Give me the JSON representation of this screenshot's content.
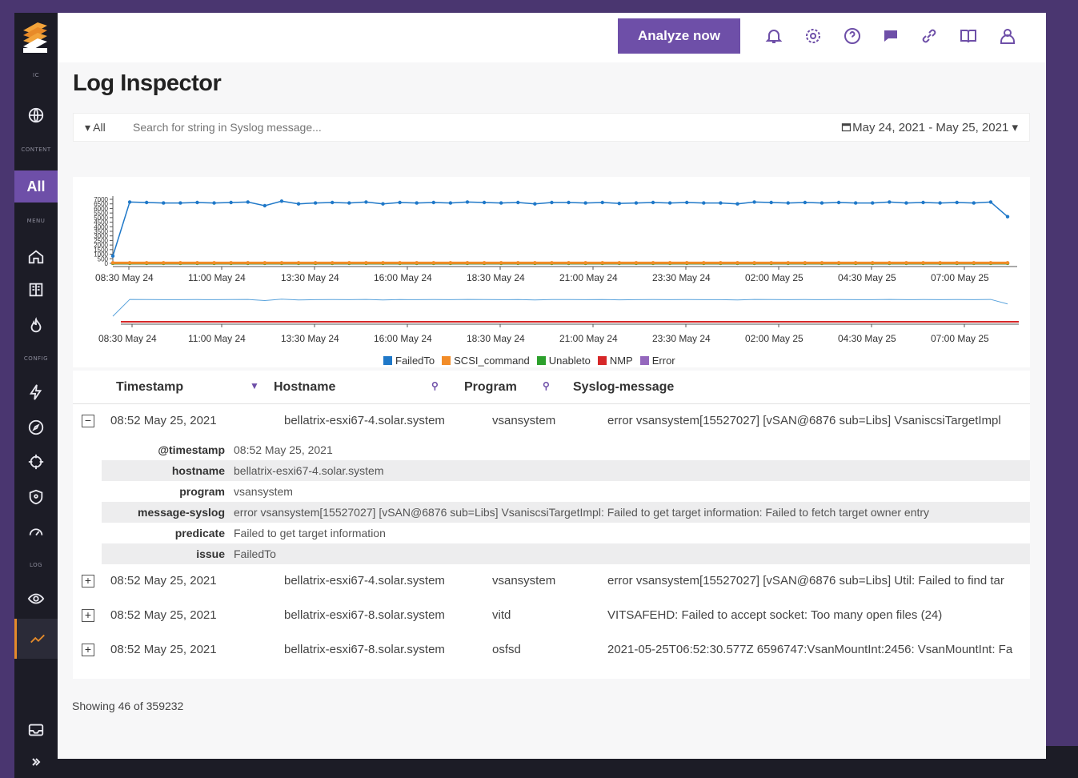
{
  "sidebar": {
    "section_labels": [
      "IC",
      "CONTENT",
      "MENU",
      "CONFIG",
      "LOG"
    ],
    "all_label": "All",
    "items": [
      {
        "icon": "globe-icon"
      },
      {
        "icon": "home-icon"
      },
      {
        "icon": "book-icon"
      },
      {
        "icon": "flame-icon"
      },
      {
        "icon": "bolt-icon"
      },
      {
        "icon": "compass-icon"
      },
      {
        "icon": "crosshair-icon"
      },
      {
        "icon": "shield-icon"
      },
      {
        "icon": "gauge-icon"
      },
      {
        "icon": "eye-icon"
      },
      {
        "icon": "trend-icon"
      },
      {
        "icon": "inbox-icon"
      },
      {
        "icon": "chevron-right-icon"
      }
    ]
  },
  "header": {
    "analyze_label": "Analyze now",
    "icons": [
      "bell-icon",
      "gear-icon",
      "help-icon",
      "chat-icon",
      "link-icon",
      "book-icon",
      "user-icon"
    ]
  },
  "page_title": "Log Inspector",
  "search": {
    "filter_label": "▾ All",
    "placeholder": "Search for string in Syslog message...",
    "date_range": "May 24, 2021 - May 25, 2021 ▾"
  },
  "chart_data": {
    "type": "line",
    "x": [
      "08:30 May 24",
      "11:00 May 24",
      "13:30 May 24",
      "16:00 May 24",
      "18:30 May 24",
      "21:00 May 24",
      "23:30 May 24",
      "02:00 May 25",
      "04:30 May 25",
      "07:00 May 25"
    ],
    "nav_x": [
      "08:30 May 24",
      "11:00 May 24",
      "13:30 May 24",
      "16:00 May 24",
      "18:30 May 24",
      "21:00 May 24",
      "23:30 May 24",
      "02:00 May 25",
      "04:30 May 25",
      "07:00 May 25"
    ],
    "yticks": [
      0,
      500,
      1000,
      1500,
      2000,
      2500,
      3000,
      3500,
      4000,
      4500,
      5000,
      5500,
      6000,
      6500,
      7000
    ],
    "ylim": [
      0,
      7000
    ],
    "series": [
      {
        "name": "FailedTo",
        "color": "#1f78c8",
        "values": [
          800,
          6700,
          6650,
          6600,
          6600,
          6650,
          6600,
          6650,
          6700,
          6300,
          6800,
          6500,
          6600,
          6650,
          6600,
          6700,
          6500,
          6650,
          6600,
          6650,
          6600,
          6700,
          6650,
          6600,
          6650,
          6500,
          6650,
          6650,
          6600,
          6650,
          6550,
          6600,
          6650,
          6600,
          6650,
          6600,
          6600,
          6500,
          6700,
          6650,
          6600,
          6650,
          6600,
          6650,
          6600,
          6600,
          6700,
          6600,
          6650,
          6600,
          6650,
          6600,
          6700,
          5100
        ]
      },
      {
        "name": "SCSI_command",
        "color": "#f28c28",
        "values": [
          60,
          60,
          60,
          60,
          60,
          60,
          60,
          60,
          60,
          60,
          60,
          60,
          60,
          60,
          60,
          60,
          60,
          60,
          60,
          60,
          60,
          60,
          60,
          60,
          60,
          60,
          60,
          60,
          60,
          60,
          60,
          60,
          60,
          60,
          60,
          60,
          60,
          60,
          60,
          60,
          60,
          60,
          60,
          60,
          60,
          60,
          60,
          60,
          60,
          60,
          60,
          60,
          60,
          60
        ]
      },
      {
        "name": "Unableto",
        "color": "#2ca02c",
        "values": [
          10,
          10,
          10,
          10,
          10,
          10,
          10,
          10,
          10,
          10,
          10,
          10,
          10,
          10,
          10,
          10,
          10,
          10,
          10,
          10,
          10,
          10,
          10,
          10,
          10,
          10,
          10,
          10,
          10,
          10,
          10,
          10,
          10,
          10,
          10,
          10,
          10,
          10,
          10,
          10,
          10,
          10,
          10,
          10,
          10,
          10,
          10,
          10,
          10,
          10,
          10,
          10,
          10,
          10
        ]
      },
      {
        "name": "NMP",
        "color": "#d62728",
        "values": [
          20,
          20,
          20,
          20,
          20,
          20,
          20,
          20,
          20,
          20,
          20,
          20,
          20,
          20,
          20,
          20,
          20,
          20,
          20,
          20,
          20,
          20,
          20,
          20,
          20,
          20,
          20,
          20,
          20,
          20,
          20,
          20,
          20,
          20,
          20,
          20,
          20,
          20,
          20,
          20,
          20,
          20,
          20,
          20,
          20,
          20,
          20,
          20,
          20,
          20,
          20,
          20,
          20,
          20
        ]
      },
      {
        "name": "Error",
        "color": "#9467bd",
        "values": [
          15,
          15,
          15,
          15,
          15,
          15,
          15,
          15,
          15,
          15,
          15,
          15,
          15,
          15,
          15,
          15,
          15,
          15,
          15,
          15,
          15,
          15,
          15,
          15,
          15,
          15,
          15,
          15,
          15,
          15,
          15,
          15,
          15,
          15,
          15,
          15,
          15,
          15,
          15,
          15,
          15,
          15,
          15,
          15,
          15,
          15,
          15,
          15,
          15,
          15,
          15,
          15,
          15,
          15
        ]
      }
    ],
    "legend_position": "bottom"
  },
  "table": {
    "columns": [
      "Timestamp",
      "Hostname",
      "Program",
      "Syslog-message"
    ],
    "expanded_row": {
      "timestamp": "08:52 May 25, 2021",
      "hostname": "bellatrix-esxi67-4.solar.system",
      "program": "vsansystem",
      "message": "error vsansystem[15527027] [vSAN@6876 sub=Libs] VsaniscsiTargetImpl",
      "details": [
        {
          "key": "@timestamp",
          "value": "08:52 May 25, 2021"
        },
        {
          "key": "hostname",
          "value": "bellatrix-esxi67-4.solar.system"
        },
        {
          "key": "program",
          "value": "vsansystem"
        },
        {
          "key": "message-syslog",
          "value": "error vsansystem[15527027] [vSAN@6876 sub=Libs] VsaniscsiTargetImpl: Failed to get target information: Failed to fetch target owner entry"
        },
        {
          "key": "predicate",
          "value": "Failed to get target information"
        },
        {
          "key": "issue",
          "value": "FailedTo"
        }
      ]
    },
    "rows": [
      {
        "timestamp": "08:52 May 25, 2021",
        "hostname": "bellatrix-esxi67-4.solar.system",
        "program": "vsansystem",
        "message": "error vsansystem[15527027] [vSAN@6876 sub=Libs] Util: Failed to find tar"
      },
      {
        "timestamp": "08:52 May 25, 2021",
        "hostname": "bellatrix-esxi67-8.solar.system",
        "program": "vitd",
        "message": "VITSAFEHD: Failed to accept socket: Too many open files (24)"
      },
      {
        "timestamp": "08:52 May 25, 2021",
        "hostname": "bellatrix-esxi67-8.solar.system",
        "program": "osfsd",
        "message": "2021-05-25T06:52:30.577Z 6596747:VsanMountInt:2456: VsanMountInt: Fa"
      }
    ]
  },
  "footer": {
    "showing": "Showing 46 of 359232"
  }
}
